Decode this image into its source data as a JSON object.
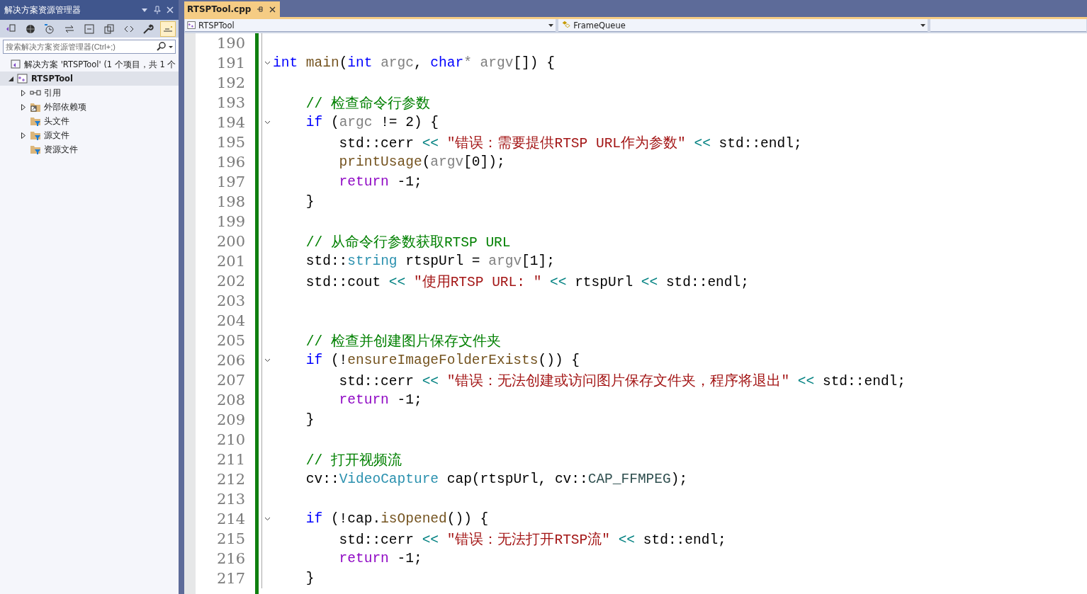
{
  "explorer": {
    "title": "解决方案资源管理器",
    "search": {
      "placeholder": "搜索解决方案资源管理器(Ctrl+;)"
    },
    "solution": {
      "label": "解决方案 'RTSPTool' (1 个项目，共 1 个"
    },
    "project": {
      "label": "RTSPTool",
      "expanded": true,
      "selected": true,
      "children": [
        {
          "label": "引用",
          "kind": "ref",
          "expandable": true
        },
        {
          "label": "外部依赖项",
          "kind": "external",
          "expandable": true
        },
        {
          "label": "头文件",
          "kind": "filter",
          "expandable": false
        },
        {
          "label": "源文件",
          "kind": "filter",
          "expandable": true
        },
        {
          "label": "资源文件",
          "kind": "filter",
          "expandable": false
        }
      ]
    }
  },
  "tabs": [
    {
      "label": "RTSPTool.cpp",
      "selected": true
    }
  ],
  "navigation": {
    "project": "RTSPTool",
    "scope": "FrameQueue"
  },
  "code_lines": [
    {
      "number": "190",
      "fold": false
    },
    {
      "number": "191",
      "fold": true,
      "tokens": [
        {
          "text": "int",
          "kind": "kw"
        },
        {
          "text": " main",
          "kind": "fn"
        },
        {
          "text": "(",
          "kind": "plain"
        },
        {
          "text": "int",
          "kind": "kw"
        },
        {
          "text": " argc",
          "kind": "param"
        },
        {
          "text": ", ",
          "kind": "plain"
        },
        {
          "text": "char",
          "kind": "kw"
        },
        {
          "text": "* argv",
          "kind": "param"
        },
        {
          "text": "[]) {",
          "kind": "plain"
        }
      ]
    },
    {
      "number": "192",
      "fold": false
    },
    {
      "number": "193",
      "fold": false,
      "tokens": [
        {
          "text": "    // 检查命令行参数",
          "kind": "cmt"
        }
      ]
    },
    {
      "number": "194",
      "fold": true,
      "tokens": [
        {
          "text": "    if",
          "kind": "kw"
        },
        {
          "text": " (",
          "kind": "plain"
        },
        {
          "text": "argc",
          "kind": "param"
        },
        {
          "text": " != 2) {",
          "kind": "plain"
        }
      ]
    },
    {
      "number": "195",
      "fold": false,
      "tokens": [
        {
          "text": "        std::cerr ",
          "kind": "plain"
        },
        {
          "text": "<<",
          "kind": "op"
        },
        {
          "text": " \"错误：需要提供RTSP URL作为参数\"",
          "kind": "str"
        },
        {
          "text": " <<",
          "kind": "op"
        },
        {
          "text": " std::endl;",
          "kind": "plain"
        }
      ]
    },
    {
      "number": "196",
      "fold": false,
      "tokens": [
        {
          "text": "        printUsage",
          "kind": "fn"
        },
        {
          "text": "(",
          "kind": "plain"
        },
        {
          "text": "argv",
          "kind": "param"
        },
        {
          "text": "[0]);",
          "kind": "plain"
        }
      ]
    },
    {
      "number": "197",
      "fold": false,
      "tokens": [
        {
          "text": "        return",
          "kind": "ctl"
        },
        {
          "text": " -1;",
          "kind": "plain"
        }
      ]
    },
    {
      "number": "198",
      "fold": false,
      "tokens": [
        {
          "text": "    }",
          "kind": "plain"
        }
      ]
    },
    {
      "number": "199",
      "fold": false
    },
    {
      "number": "200",
      "fold": false,
      "tokens": [
        {
          "text": "    // 从命令行参数获取RTSP URL",
          "kind": "cmt"
        }
      ]
    },
    {
      "number": "201",
      "fold": false,
      "tokens": [
        {
          "text": "    std::",
          "kind": "plain"
        },
        {
          "text": "string",
          "kind": "cls"
        },
        {
          "text": " rtspUrl = ",
          "kind": "plain"
        },
        {
          "text": "argv",
          "kind": "param"
        },
        {
          "text": "[1];",
          "kind": "plain"
        }
      ]
    },
    {
      "number": "202",
      "fold": false,
      "tokens": [
        {
          "text": "    std::cout ",
          "kind": "plain"
        },
        {
          "text": "<<",
          "kind": "op"
        },
        {
          "text": " \"使用RTSP URL: \"",
          "kind": "str"
        },
        {
          "text": " <<",
          "kind": "op"
        },
        {
          "text": " rtspUrl ",
          "kind": "plain"
        },
        {
          "text": "<<",
          "kind": "op"
        },
        {
          "text": " std::endl;",
          "kind": "plain"
        }
      ]
    },
    {
      "number": "203",
      "fold": false
    },
    {
      "number": "204",
      "fold": false
    },
    {
      "number": "205",
      "fold": false,
      "tokens": [
        {
          "text": "    // 检查并创建图片保存文件夹",
          "kind": "cmt"
        }
      ]
    },
    {
      "number": "206",
      "fold": true,
      "tokens": [
        {
          "text": "    if",
          "kind": "kw"
        },
        {
          "text": " (!",
          "kind": "plain"
        },
        {
          "text": "ensureImageFolderExists",
          "kind": "fn"
        },
        {
          "text": "()) {",
          "kind": "plain"
        }
      ]
    },
    {
      "number": "207",
      "fold": false,
      "tokens": [
        {
          "text": "        std::cerr ",
          "kind": "plain"
        },
        {
          "text": "<<",
          "kind": "op"
        },
        {
          "text": " \"错误：无法创建或访问图片保存文件夹，程序将退出\"",
          "kind": "str"
        },
        {
          "text": " <<",
          "kind": "op"
        },
        {
          "text": " std::endl;",
          "kind": "plain"
        }
      ]
    },
    {
      "number": "208",
      "fold": false,
      "tokens": [
        {
          "text": "        return",
          "kind": "ctl"
        },
        {
          "text": " -1;",
          "kind": "plain"
        }
      ]
    },
    {
      "number": "209",
      "fold": false,
      "tokens": [
        {
          "text": "    }",
          "kind": "plain"
        }
      ]
    },
    {
      "number": "210",
      "fold": false
    },
    {
      "number": "211",
      "fold": false,
      "tokens": [
        {
          "text": "    // 打开视频流",
          "kind": "cmt"
        }
      ]
    },
    {
      "number": "212",
      "fold": false,
      "tokens": [
        {
          "text": "    cv::",
          "kind": "plain"
        },
        {
          "text": "VideoCapture",
          "kind": "cls"
        },
        {
          "text": " cap(rtspUrl, cv::",
          "kind": "plain"
        },
        {
          "text": "CAP_FFMPEG",
          "kind": "enum"
        },
        {
          "text": ");",
          "kind": "plain"
        }
      ]
    },
    {
      "number": "213",
      "fold": false
    },
    {
      "number": "214",
      "fold": true,
      "tokens": [
        {
          "text": "    if",
          "kind": "kw"
        },
        {
          "text": " (!cap.",
          "kind": "plain"
        },
        {
          "text": "isOpened",
          "kind": "fn"
        },
        {
          "text": "()) {",
          "kind": "plain"
        }
      ]
    },
    {
      "number": "215",
      "fold": false,
      "tokens": [
        {
          "text": "        std::cerr ",
          "kind": "plain"
        },
        {
          "text": "<<",
          "kind": "op"
        },
        {
          "text": " \"错误：无法打开RTSP流\"",
          "kind": "str"
        },
        {
          "text": " <<",
          "kind": "op"
        },
        {
          "text": " std::endl;",
          "kind": "plain"
        }
      ]
    },
    {
      "number": "216",
      "fold": false,
      "tokens": [
        {
          "text": "        return",
          "kind": "ctl"
        },
        {
          "text": " -1;",
          "kind": "plain"
        }
      ]
    },
    {
      "number": "217",
      "fold": false,
      "tokens": [
        {
          "text": "    }",
          "kind": "plain"
        }
      ]
    }
  ]
}
